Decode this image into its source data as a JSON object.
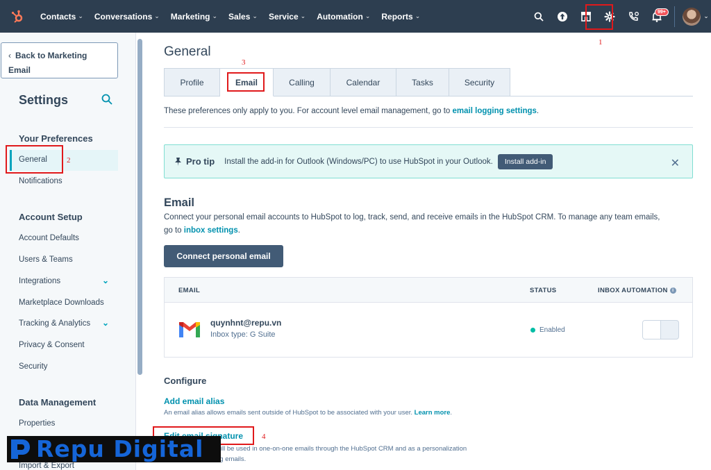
{
  "nav": {
    "items": [
      "Contacts",
      "Conversations",
      "Marketing",
      "Sales",
      "Service",
      "Automation",
      "Reports"
    ],
    "notif_count": "99+"
  },
  "sidebar": {
    "back_label": "Back to Marketing Email",
    "title": "Settings",
    "sections": [
      {
        "heading": "Your Preferences",
        "items": [
          "General",
          "Notifications"
        ]
      },
      {
        "heading": "Account Setup",
        "items": [
          "Account Defaults",
          "Users & Teams",
          "Integrations",
          "Marketplace Downloads",
          "Tracking & Analytics",
          "Privacy & Consent",
          "Security"
        ]
      },
      {
        "heading": "Data Management",
        "items": [
          "Properties",
          "Import & Export"
        ]
      }
    ]
  },
  "main": {
    "title": "General",
    "tabs": [
      "Profile",
      "Email",
      "Calling",
      "Calendar",
      "Tasks",
      "Security"
    ],
    "active_tab": "Email",
    "pref_note": "These preferences only apply to you. For account level email management, go to ",
    "pref_link": "email logging settings",
    "pref_end": ".",
    "protip": {
      "title": "Pro tip",
      "text": "Install the add-in for Outlook (Windows/PC) to use HubSpot in your Outlook.",
      "button": "Install add-in"
    },
    "email_heading": "Email",
    "email_desc": "Connect your personal email accounts to HubSpot to log, track, send, and receive emails in the HubSpot CRM. To manage any team emails, go to ",
    "email_desc_link": "inbox settings",
    "email_desc_end": ".",
    "connect_button": "Connect personal email",
    "table": {
      "col_email": "EMAIL",
      "col_status": "STATUS",
      "col_inbox": "INBOX AUTOMATION",
      "address": "quynhnt@repu.vn",
      "inbox_type": "Inbox type: G Suite",
      "status": "Enabled"
    },
    "configure_heading": "Configure",
    "alias_link": "Add email alias",
    "alias_desc": "An email alias allows emails sent outside of HubSpot to be associated with your user. ",
    "alias_learn": "Learn more",
    "alias_end": ".",
    "signature_link": "Edit email signature",
    "signature_desc": "will be used in one-on-one emails through the HubSpot CRM and as a personalization",
    "signature_desc2": "ng emails."
  },
  "annotations": [
    "1",
    "2",
    "3",
    "4"
  ],
  "watermark": "Repu Digital",
  "colors": {
    "nav_bg": "#2d3e50",
    "accent": "#00a4bd",
    "link": "#0091ae",
    "button_dark": "#425b76",
    "annotation": "#e0191b",
    "protip_bg": "#e5f8f6",
    "watermark_blue": "#1565d8"
  }
}
